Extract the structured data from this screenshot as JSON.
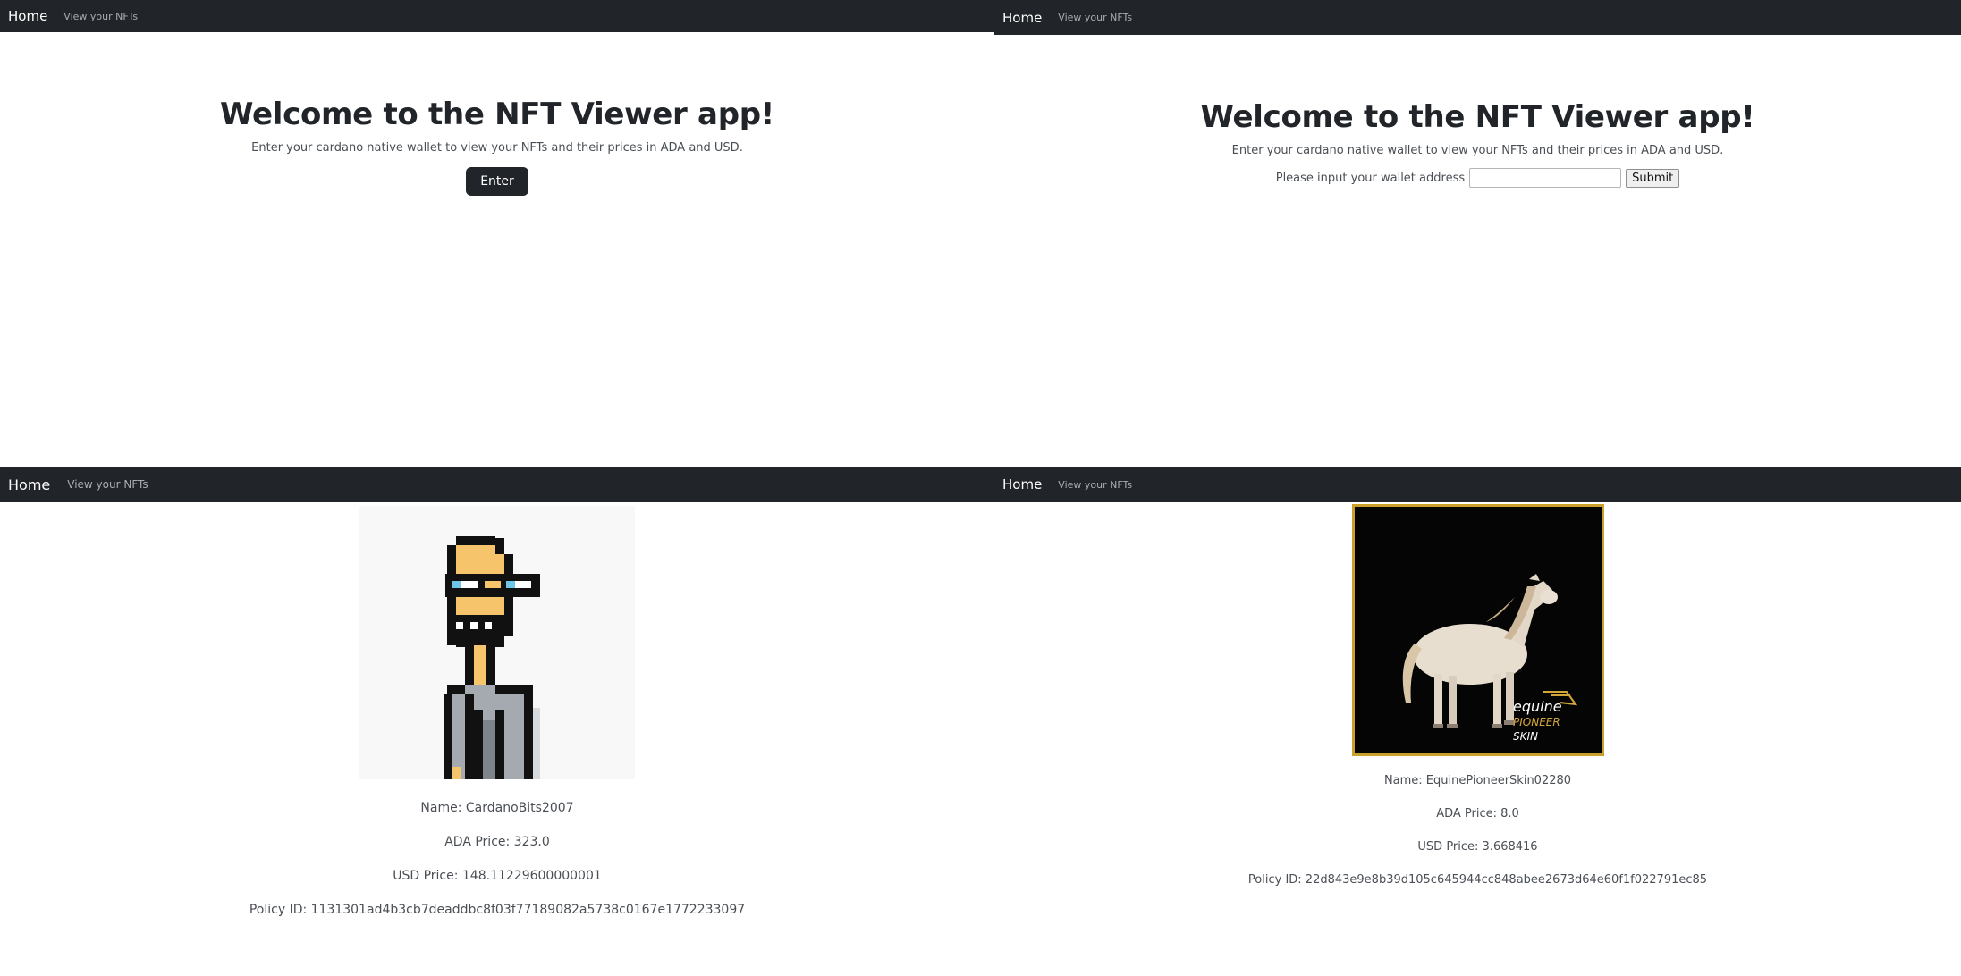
{
  "nav": {
    "home_label": "Home",
    "nfts_label": "View your NFTs"
  },
  "welcome": {
    "title": "Welcome to the NFT Viewer app!",
    "subtitle": "Enter your cardano native wallet to view your NFTs and their prices in ADA and USD.",
    "enter_label": "Enter"
  },
  "wallet_form": {
    "prompt": "Please input your wallet address",
    "input_value": "",
    "submit_label": "Submit"
  },
  "nft1": {
    "image_icon": "pixel-art-cardanobits-character",
    "name": "Name: CardanoBits2007",
    "ada_price": "ADA Price: 323.0",
    "usd_price": "USD Price: 148.11229600000001",
    "policy_id": "Policy ID: 1131301ad4b3cb7deaddbc8f03f77189082a5738c0167e1772233097"
  },
  "nft2": {
    "image_icon": "white-horse-artwork",
    "brand_line1": "equine",
    "brand_line2": "PIONEER",
    "brand_line3": "SKIN",
    "name": "Name: EquinePioneerSkin02280",
    "ada_price": "ADA Price: 8.0",
    "usd_price": "USD Price: 3.668416",
    "policy_id": "Policy ID: 22d843e9e8b39d105c645944cc848abee2673d64e60f1f022791ec85"
  },
  "colors": {
    "navbar": "#212529",
    "gold_frame": "#c9a12a"
  }
}
